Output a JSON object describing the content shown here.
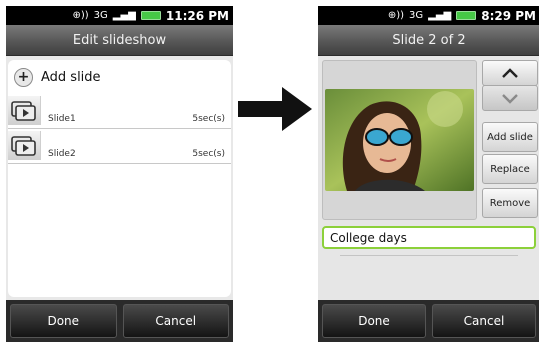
{
  "left_screen": {
    "status_time": "11:26 PM",
    "title": "Edit slideshow",
    "add_slide_label": "Add slide",
    "slides": [
      {
        "label": "Slide1",
        "duration": "5sec(s)"
      },
      {
        "label": "Slide2",
        "duration": "5sec(s)"
      }
    ],
    "buttons": {
      "done": "Done",
      "cancel": "Cancel"
    }
  },
  "right_screen": {
    "status_time": "8:29 PM",
    "title": "Slide 2 of 2",
    "side_buttons": {
      "add_slide": "Add slide",
      "replace": "Replace",
      "remove": "Remove"
    },
    "caption_value": "College days",
    "buttons": {
      "done": "Done",
      "cancel": "Cancel"
    }
  },
  "icons": {
    "status": [
      "gps-icon",
      "3g-icon",
      "signal-icon",
      "battery-icon"
    ],
    "add": "plus-circle-icon",
    "slide_thumb": "slideshow-icon",
    "move_up": "chevron-up-icon",
    "move_down": "chevron-down-icon",
    "transition": "right-arrow-icon"
  },
  "colors": {
    "accent_green": "#8cd03a",
    "battery_green": "#47c847"
  }
}
